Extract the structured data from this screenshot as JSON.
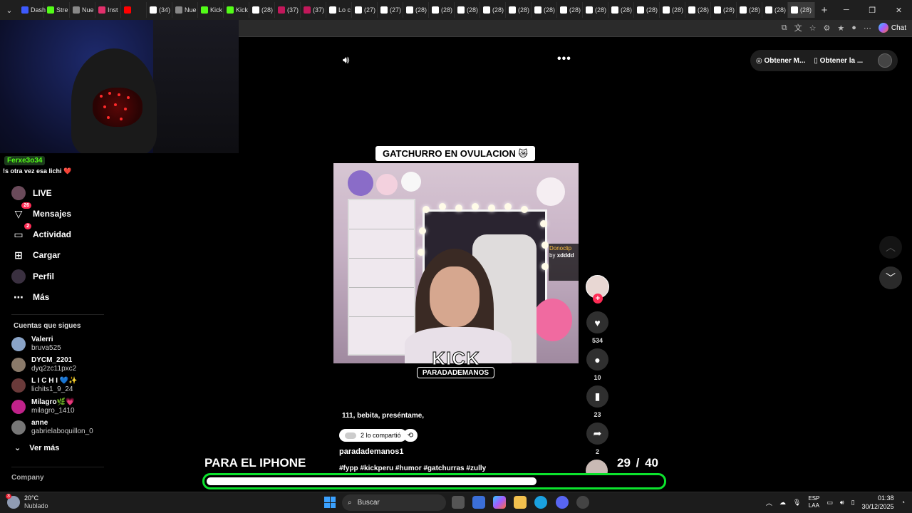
{
  "browser": {
    "tabs": [
      {
        "label": "Dash",
        "color": "#3d5afe"
      },
      {
        "label": "Stre",
        "color": "#53fc18"
      },
      {
        "label": "Nue",
        "color": "#888888"
      },
      {
        "label": "Inst",
        "color": "#e1306c"
      },
      {
        "label": "",
        "color": "#ff0000"
      },
      {
        "label": "(34)",
        "color": "#ffffff"
      },
      {
        "label": "Nue",
        "color": "#888888"
      },
      {
        "label": "Kick",
        "color": "#53fc18"
      },
      {
        "label": "Kick",
        "color": "#53fc18"
      },
      {
        "label": "(28)",
        "color": "#ffffff"
      },
      {
        "label": "(37)",
        "color": "#c2185b"
      },
      {
        "label": "(37)",
        "color": "#c2185b"
      },
      {
        "label": "Lo c",
        "color": "#ffffff"
      },
      {
        "label": "(27)",
        "color": "#ffffff"
      },
      {
        "label": "(27)",
        "color": "#ffffff"
      },
      {
        "label": "(28)",
        "color": "#ffffff"
      },
      {
        "label": "(28)",
        "color": "#ffffff"
      },
      {
        "label": "(28)",
        "color": "#ffffff"
      },
      {
        "label": "(28)",
        "color": "#ffffff"
      },
      {
        "label": "(28)",
        "color": "#ffffff"
      },
      {
        "label": "(28)",
        "color": "#ffffff"
      },
      {
        "label": "(28)",
        "color": "#ffffff"
      },
      {
        "label": "(28)",
        "color": "#ffffff"
      },
      {
        "label": "(28)",
        "color": "#ffffff"
      },
      {
        "label": "(28)",
        "color": "#ffffff"
      },
      {
        "label": "(28)",
        "color": "#ffffff"
      },
      {
        "label": "(28)",
        "color": "#ffffff"
      },
      {
        "label": "(28)",
        "color": "#ffffff"
      },
      {
        "label": "(28)",
        "color": "#ffffff"
      },
      {
        "label": "(28)",
        "color": "#ffffff"
      },
      {
        "label": "(28)",
        "color": "#ffffff"
      }
    ],
    "chat_label": "Chat"
  },
  "stream_overlay": {
    "chat_user": "Ferxe3o34",
    "chat_message": "!s otra vez esa lichi ❤️",
    "promo_text": "PARA EL IPHONE",
    "counter_current": "29",
    "counter_total": "/ 40",
    "progress": 0.725,
    "progress_color": "#0ce32d"
  },
  "sidebar": {
    "nav": [
      {
        "label": "LIVE",
        "icon": "live-icon",
        "badge": ""
      },
      {
        "label": "Mensajes",
        "icon": "messages-icon",
        "badge": "26"
      },
      {
        "label": "Actividad",
        "icon": "activity-icon",
        "badge": "2"
      },
      {
        "label": "Cargar",
        "icon": "upload-icon",
        "badge": ""
      },
      {
        "label": "Perfil",
        "icon": "profile-icon",
        "badge": ""
      },
      {
        "label": "Más",
        "icon": "more-icon",
        "badge": ""
      }
    ],
    "following_title": "Cuentas que sigues",
    "accounts": [
      {
        "name": "Valerri",
        "handle": "bruva525",
        "color": "#8aa4c8"
      },
      {
        "name": "DYCM_2201",
        "handle": "dyq2zc11pxc2",
        "color": "#8a7a6a"
      },
      {
        "name": "L I C H I 💙✨",
        "handle": "lichits1_9_24",
        "color": "#6a3a3a"
      },
      {
        "name": "Milagro🌿💗",
        "handle": "milagro_1410",
        "color": "#c0228a"
      },
      {
        "name": "anne",
        "handle": "gabrielaboquillon_0",
        "color": "#777777"
      }
    ],
    "see_more": "Ver más",
    "company": "Company"
  },
  "player": {
    "top_actions": [
      "Obtener M...",
      "Obtener la ..."
    ],
    "video_title": "GATCHURRO EN OVULACION 😿",
    "watermark_logo": "KICK",
    "watermark_handle": "PARADADEMANOS",
    "donoclip_title": "Donoclip",
    "donoclip_by": "by",
    "donoclip_user": "xdddd",
    "caption": "111, bebita, preséntame,",
    "shared_text": "2 lo compartió",
    "author": "paradademanos1",
    "hashtags": "#fypp #kickperu #humor #gatchurras #zully",
    "likes": "534",
    "comments": "10",
    "saves": "23",
    "shares": "2"
  },
  "taskbar": {
    "temperature": "20°C",
    "weather": "Nublado",
    "weather_badge": "3",
    "search_placeholder": "Buscar",
    "lang_top": "ESP",
    "lang_bottom": "LAA",
    "time": "01:38",
    "date": "30/12/2025"
  }
}
